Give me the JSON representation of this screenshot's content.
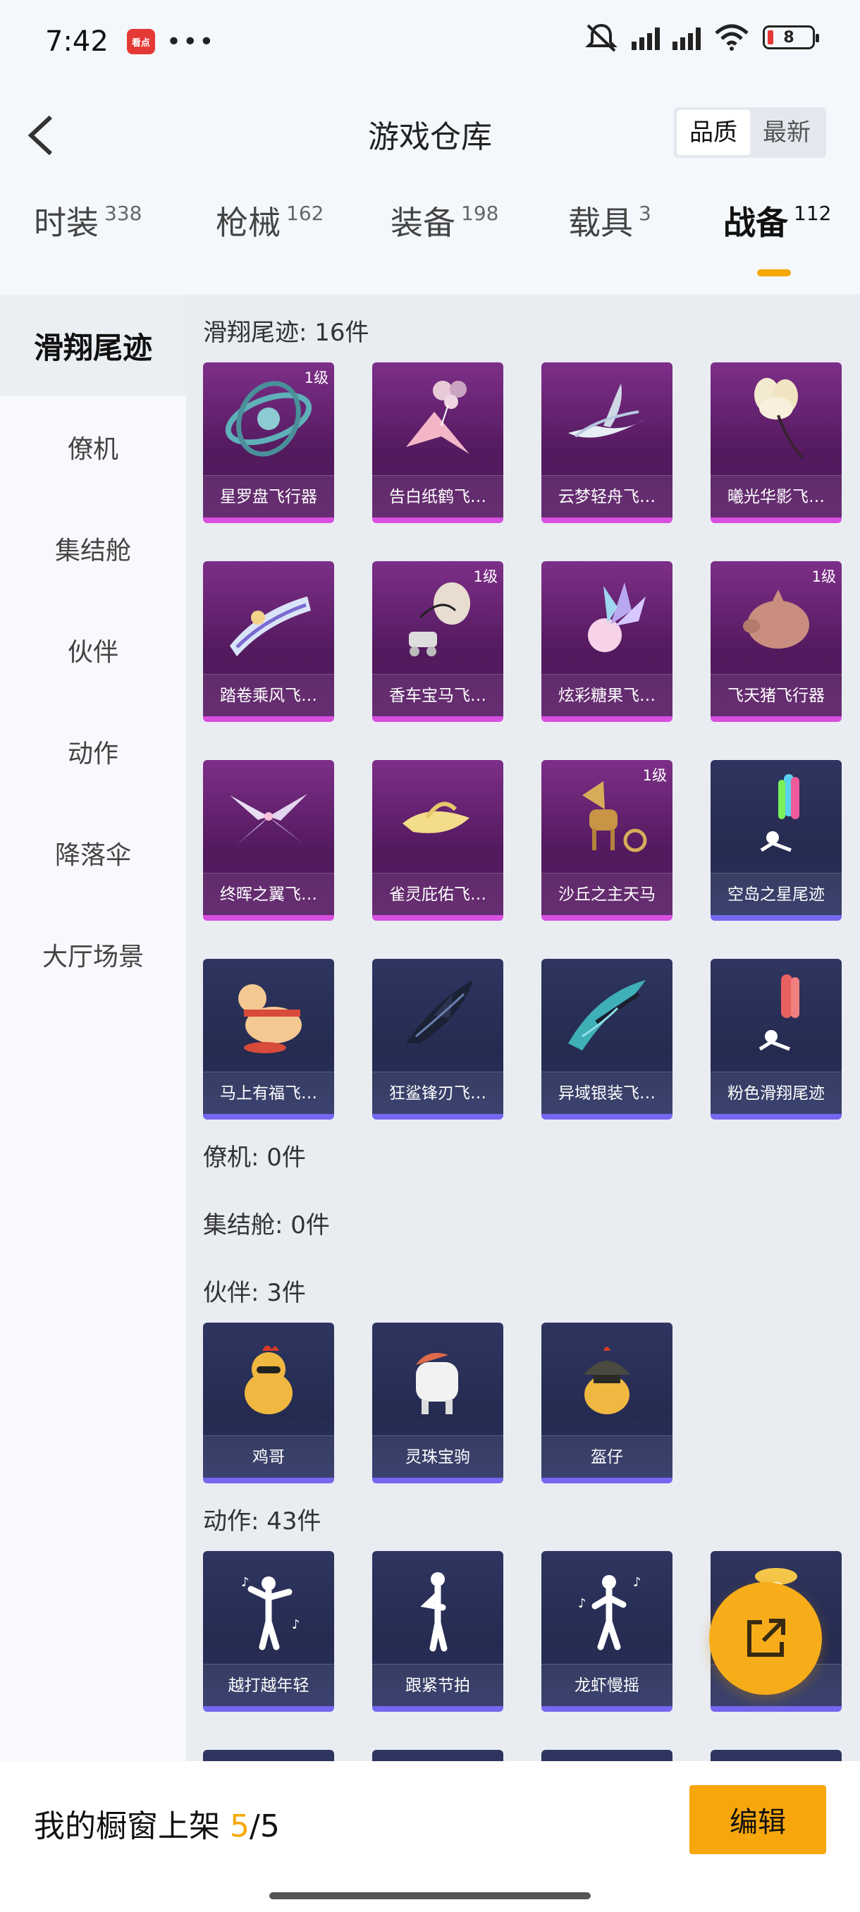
{
  "status_bar": {
    "time": "7:42",
    "app_badge": "看点",
    "battery": "8"
  },
  "header": {
    "title": "游戏仓库",
    "sort_options": [
      "品质",
      "最新"
    ],
    "sort_active": "品质"
  },
  "tabs": [
    {
      "label": "时装",
      "count": "338"
    },
    {
      "label": "枪械",
      "count": "162"
    },
    {
      "label": "装备",
      "count": "198"
    },
    {
      "label": "载具",
      "count": "3"
    },
    {
      "label": "战备",
      "count": "112"
    }
  ],
  "active_tab": "战备",
  "sidebar": [
    "滑翔尾迹",
    "僚机",
    "集结舱",
    "伙伴",
    "动作",
    "降落伞",
    "大厅场景"
  ],
  "sections": {
    "glide": {
      "title": "滑翔尾迹: 16件",
      "items": [
        {
          "name": "星罗盘飞行器",
          "level": "1级",
          "icon": "astrolabe-glider-icon"
        },
        {
          "name": "告白纸鹤飞…",
          "level": "",
          "icon": "paper-crane-glider-icon"
        },
        {
          "name": "云梦轻舟飞…",
          "level": "",
          "icon": "cloud-boat-glider-icon"
        },
        {
          "name": "曦光华影飞…",
          "level": "",
          "icon": "flower-glider-icon"
        },
        {
          "name": "踏卷乘风飞…",
          "level": "",
          "icon": "scroll-glider-icon"
        },
        {
          "name": "香车宝马飞…",
          "level": "1级",
          "icon": "carriage-glider-icon"
        },
        {
          "name": "炫彩糖果飞…",
          "level": "",
          "icon": "candy-glider-icon"
        },
        {
          "name": "飞天猪飞行器",
          "level": "1级",
          "icon": "flying-pig-icon"
        },
        {
          "name": "终晖之翼飞…",
          "level": "",
          "icon": "wings-glider-icon"
        },
        {
          "name": "雀灵庇佑飞…",
          "level": "",
          "icon": "bird-glider-icon"
        },
        {
          "name": "沙丘之主天马",
          "level": "1级",
          "icon": "pegasus-icon"
        },
        {
          "name": "空岛之星尾迹",
          "level": "",
          "icon": "rainbow-trail-icon"
        },
        {
          "name": "马上有福飞…",
          "level": "",
          "icon": "horse-glider-icon"
        },
        {
          "name": "狂鲨锋刃飞…",
          "level": "",
          "icon": "shark-glider-icon"
        },
        {
          "name": "异域银装飞…",
          "level": "",
          "icon": "silver-glider-icon"
        },
        {
          "name": "粉色滑翔尾迹",
          "level": "",
          "icon": "pink-trail-icon"
        }
      ]
    },
    "wingman": {
      "title": "僚机: 0件"
    },
    "capsule": {
      "title": "集结舱: 0件"
    },
    "partner": {
      "title": "伙伴: 3件",
      "items": [
        {
          "name": "鸡哥",
          "icon": "chicken-icon"
        },
        {
          "name": "灵珠宝驹",
          "icon": "pony-icon"
        },
        {
          "name": "盔仔",
          "icon": "helmet-chick-icon"
        }
      ]
    },
    "emote": {
      "title": "动作: 43件",
      "items": [
        {
          "name": "越打越年轻",
          "icon": "dance-figure-icon"
        },
        {
          "name": "跟紧节拍",
          "icon": "dance-figure-icon"
        },
        {
          "name": "龙虾慢摇",
          "icon": "dance-figure-icon"
        },
        {
          "name": "",
          "icon": "hat-figure-icon"
        }
      ]
    }
  },
  "bottom": {
    "showcase_label": "我的橱窗上架",
    "showcase_current": "5",
    "showcase_total": "/5",
    "edit_label": "编辑"
  },
  "colors": {
    "accent": "#f5a800",
    "purple_card": "#6a2575",
    "blue_card": "#2a3058"
  }
}
